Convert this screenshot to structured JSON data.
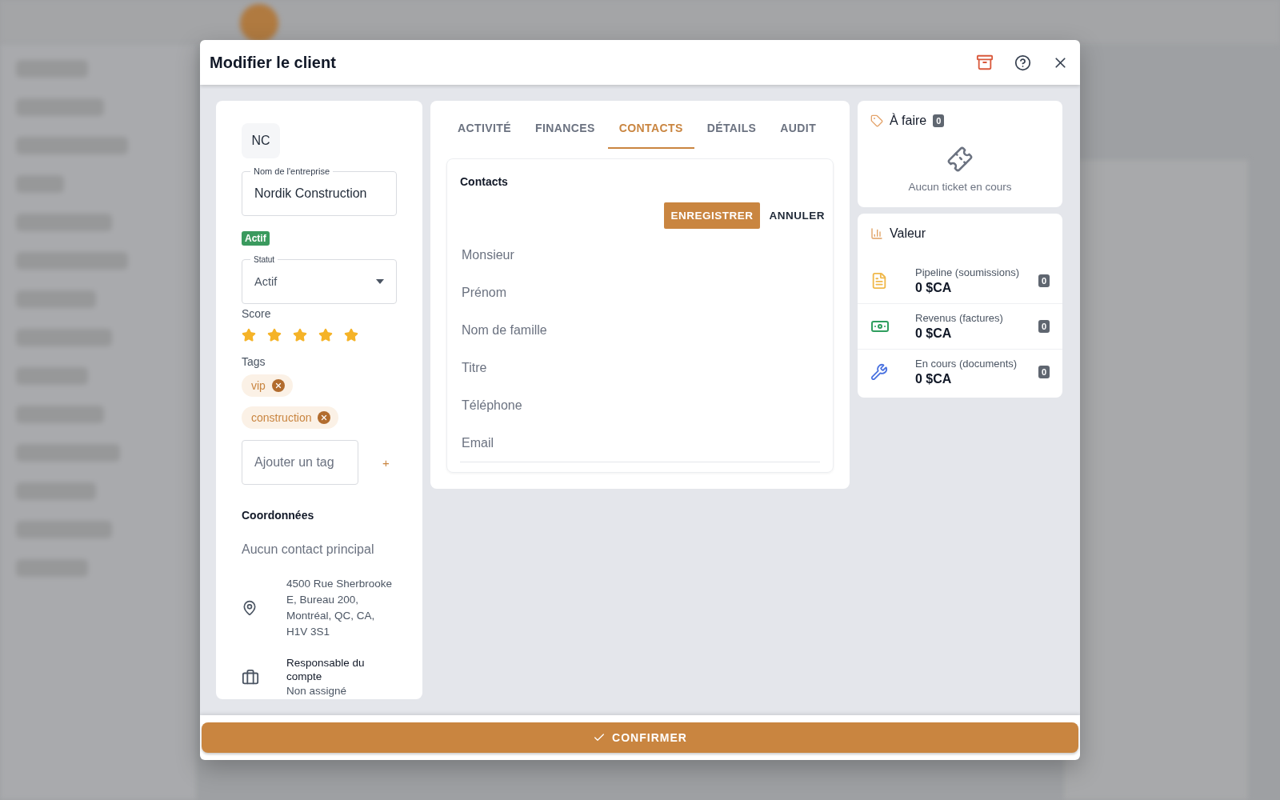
{
  "dialog": {
    "title": "Modifier le client",
    "confirm_label": "CONFIRMER"
  },
  "profile": {
    "initials": "NC",
    "company_label": "Nom de l'entreprise",
    "company_value": "Nordik Construction",
    "status_badge": "Actif",
    "status_label": "Statut",
    "status_value": "Actif",
    "score_label": "Score",
    "stars": 5,
    "tags_label": "Tags",
    "tags": [
      "vip",
      "construction"
    ],
    "tag_placeholder": "Ajouter un tag",
    "add_symbol": "+",
    "coords_label": "Coordonnées",
    "no_contact": "Aucun contact principal",
    "address": "4500 Rue Sherbrooke E, Bureau 200, Montréal, QC, CA, H1V 3S1",
    "manager_label": "Responsable du compte",
    "manager_value": "Non assigné"
  },
  "tabs": [
    {
      "label": "ACTIVITÉ",
      "selected": false
    },
    {
      "label": "FINANCES",
      "selected": false
    },
    {
      "label": "CONTACTS",
      "selected": true
    },
    {
      "label": "DÉTAILS",
      "selected": false
    },
    {
      "label": "AUDIT",
      "selected": false
    }
  ],
  "contacts": {
    "title": "Contacts",
    "save": "ENREGISTRER",
    "cancel": "ANNULER",
    "fields": [
      {
        "placeholder": "Monsieur"
      },
      {
        "placeholder": "Prénom"
      },
      {
        "placeholder": "Nom de famille"
      },
      {
        "placeholder": "Titre"
      },
      {
        "placeholder": "Téléphone"
      },
      {
        "placeholder": "Email"
      }
    ]
  },
  "todo": {
    "title": "À faire",
    "count": "0",
    "empty": "Aucun ticket en cours"
  },
  "value": {
    "title": "Valeur",
    "rows": [
      {
        "kind": "quotes",
        "label": "Pipeline (soumissions)",
        "amount": "0 $CA",
        "count": "0"
      },
      {
        "kind": "invoices",
        "label": "Revenus (factures)",
        "amount": "0 $CA",
        "count": "0"
      },
      {
        "kind": "work",
        "label": "En cours (documents)",
        "amount": "0 $CA",
        "count": "0"
      }
    ]
  }
}
